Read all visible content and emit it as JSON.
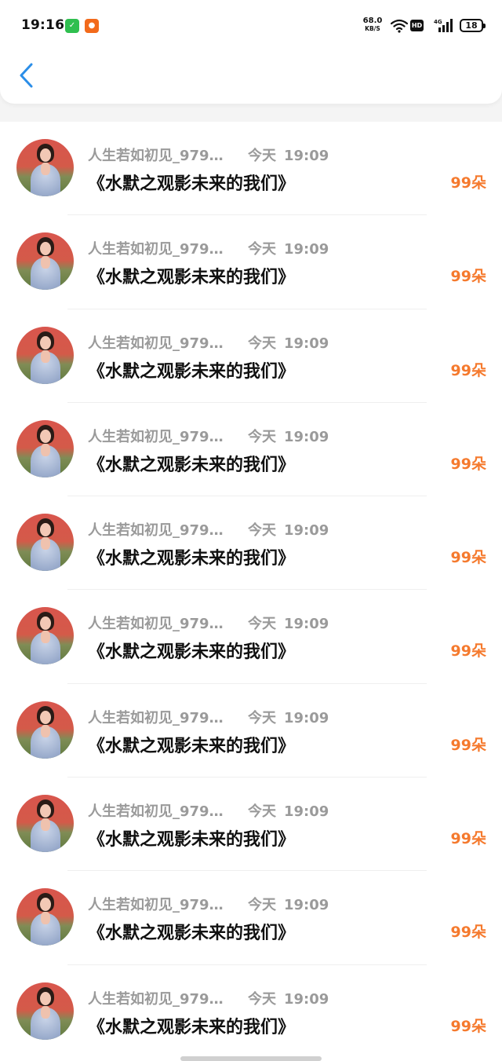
{
  "status_bar": {
    "time": "19:16",
    "net_speed": "68.0",
    "net_unit": "KB/S",
    "hd_label": "HD",
    "network_label": "4G",
    "battery": "18",
    "app_icons": [
      {
        "name": "wechat-pay-icon",
        "glyph": "✓",
        "color": "#2fbf4f"
      },
      {
        "name": "video-app-icon",
        "glyph": "●",
        "color": "#f26a1b"
      }
    ]
  },
  "nav": {
    "back_icon": "chevron-left-icon",
    "back_color": "#2b8ee8"
  },
  "colors": {
    "amount": "#f57a2e",
    "meta": "#9a9a9a",
    "title": "#111111"
  },
  "records": [
    {
      "username": "人生若如初见_979…",
      "day": "今天",
      "time": "19:09",
      "title": "《水默之观影未来的我们》",
      "amount": "99朵"
    },
    {
      "username": "人生若如初见_979…",
      "day": "今天",
      "time": "19:09",
      "title": "《水默之观影未来的我们》",
      "amount": "99朵"
    },
    {
      "username": "人生若如初见_979…",
      "day": "今天",
      "time": "19:09",
      "title": "《水默之观影未来的我们》",
      "amount": "99朵"
    },
    {
      "username": "人生若如初见_979…",
      "day": "今天",
      "time": "19:09",
      "title": "《水默之观影未来的我们》",
      "amount": "99朵"
    },
    {
      "username": "人生若如初见_979…",
      "day": "今天",
      "time": "19:09",
      "title": "《水默之观影未来的我们》",
      "amount": "99朵"
    },
    {
      "username": "人生若如初见_979…",
      "day": "今天",
      "time": "19:09",
      "title": "《水默之观影未来的我们》",
      "amount": "99朵"
    },
    {
      "username": "人生若如初见_979…",
      "day": "今天",
      "time": "19:09",
      "title": "《水默之观影未来的我们》",
      "amount": "99朵"
    },
    {
      "username": "人生若如初见_979…",
      "day": "今天",
      "time": "19:09",
      "title": "《水默之观影未来的我们》",
      "amount": "99朵"
    },
    {
      "username": "人生若如初见_979…",
      "day": "今天",
      "time": "19:09",
      "title": "《水默之观影未来的我们》",
      "amount": "99朵"
    },
    {
      "username": "人生若如初见_979…",
      "day": "今天",
      "time": "19:09",
      "title": "《水默之观影未来的我们》",
      "amount": "99朵"
    }
  ]
}
